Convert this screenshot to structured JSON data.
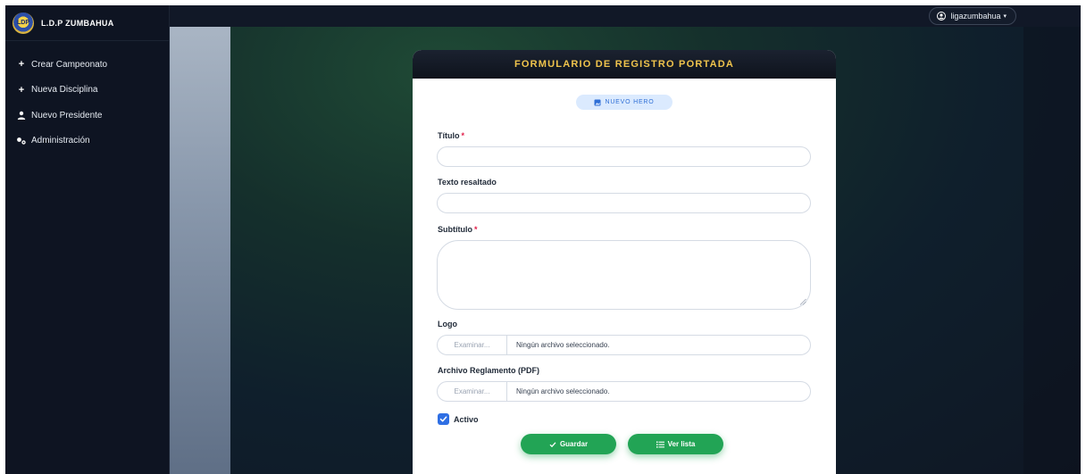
{
  "brand": {
    "name": "L.D.P ZUMBAHUA",
    "logo_text": "LDP"
  },
  "sidebar": {
    "items": [
      {
        "label": "Crear Campeonato",
        "icon": "plus-icon"
      },
      {
        "label": "Nueva Disciplina",
        "icon": "plus-icon"
      },
      {
        "label": "Nuevo Presidente",
        "icon": "user-icon"
      },
      {
        "label": "Administración",
        "icon": "users-cog-icon"
      }
    ]
  },
  "topbar": {
    "user_label": "ligazumbahua",
    "user_icon": "user-circle-icon",
    "caret": "▾"
  },
  "form": {
    "title": "FORMULARIO DE REGISTRO PORTADA",
    "badge": "NUEVO HERO",
    "fields": {
      "titulo": {
        "label": "Título",
        "required": "*",
        "value": ""
      },
      "texto_resaltado": {
        "label": "Texto resaltado",
        "value": ""
      },
      "subtitulo": {
        "label": "Subtítulo",
        "required": "*",
        "value": ""
      },
      "logo": {
        "label": "Logo",
        "button": "Examinar...",
        "status": "Ningún archivo seleccionado."
      },
      "reglamento": {
        "label": "Archivo Reglamento (PDF)",
        "button": "Examinar...",
        "status": "Ningún archivo seleccionado."
      },
      "activo": {
        "label": "Activo",
        "checked": true
      }
    },
    "buttons": {
      "save": "Guardar",
      "list": "Ver lista"
    }
  },
  "colors": {
    "accent_gold": "#f0c44c",
    "primary_blue": "#2f6fe4",
    "success_green": "#22a455",
    "sidebar_bg": "#0e1422"
  }
}
